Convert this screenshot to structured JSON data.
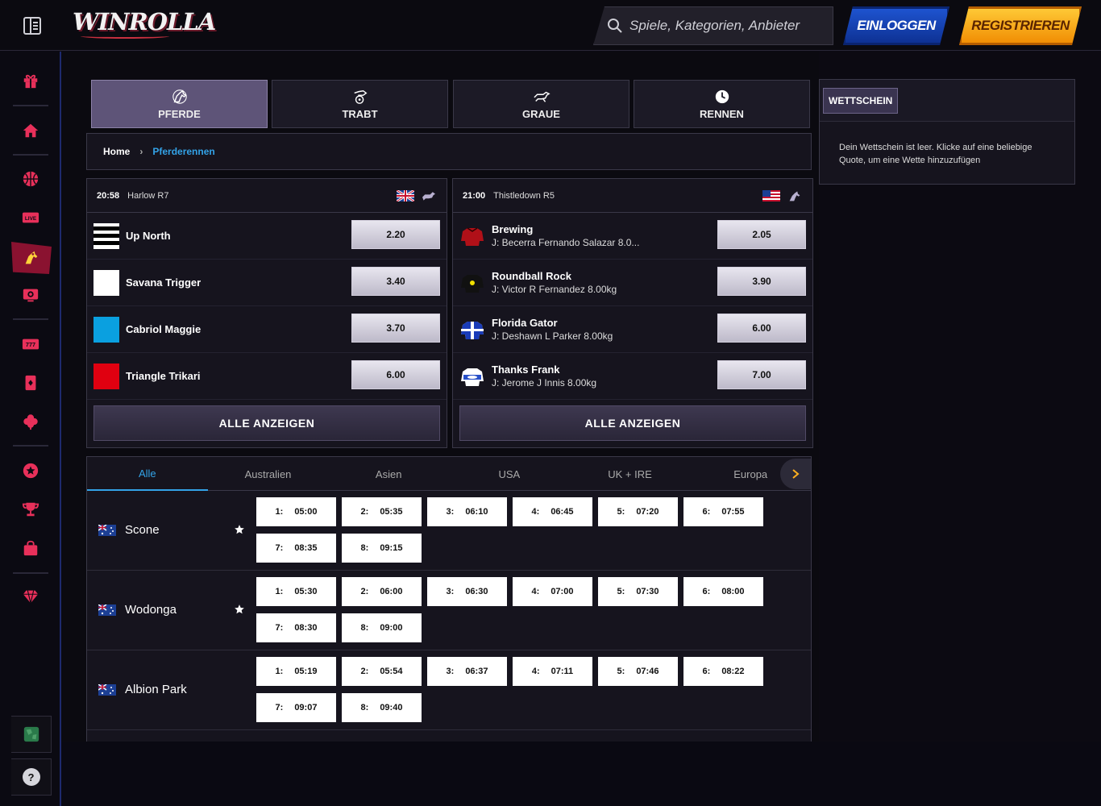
{
  "header": {
    "logo_text": "WINROLLA",
    "search_placeholder": "Spiele, Kategorien, Anbieter",
    "login_label": "EINLOGGEN",
    "register_label": "REGISTRIEREN"
  },
  "sidebar": {
    "live_badge": "LIVE",
    "slots_badge": "777",
    "help_label": "?"
  },
  "categories": [
    {
      "label": "PFERDE",
      "icon": "horse-icon",
      "active": true
    },
    {
      "label": "TRABT",
      "icon": "harness-icon",
      "active": false
    },
    {
      "label": "GRAUE",
      "icon": "greyhound-icon",
      "active": false
    },
    {
      "label": "RENNEN",
      "icon": "clock-icon",
      "active": false
    }
  ],
  "breadcrumb": {
    "home": "Home",
    "current": "Pferderennen"
  },
  "races": [
    {
      "time": "20:58",
      "name": "Harlow R7",
      "country_flag": "uk-flag-icon",
      "show_all": "ALLE ANZEIGEN",
      "runners": [
        {
          "name": "Up North",
          "jockey": "",
          "odds": "2.20"
        },
        {
          "name": "Savana Trigger",
          "jockey": "",
          "odds": "3.40"
        },
        {
          "name": "Cabriol Maggie",
          "jockey": "",
          "odds": "3.70"
        },
        {
          "name": "Triangle Trikari",
          "jockey": "",
          "odds": "6.00"
        }
      ]
    },
    {
      "time": "21:00",
      "name": "Thistledown R5",
      "country_flag": "us-flag-icon",
      "show_all": "ALLE ANZEIGEN",
      "runners": [
        {
          "name": "Brewing",
          "jockey": "J: Becerra Fernando Salazar 8.0...",
          "odds": "2.05"
        },
        {
          "name": "Roundball Rock",
          "jockey": "J: Victor R Fernandez 8.00kg",
          "odds": "3.90"
        },
        {
          "name": "Florida Gator",
          "jockey": "J: Deshawn L Parker 8.00kg",
          "odds": "6.00"
        },
        {
          "name": "Thanks Frank",
          "jockey": "J: Jerome J Innis 8.00kg",
          "odds": "7.00"
        }
      ]
    }
  ],
  "region_tabs": [
    "Alle",
    "Australien",
    "Asien",
    "USA",
    "UK + IRE",
    "Europa"
  ],
  "active_region": "Alle",
  "meetings": [
    {
      "name": "Scone",
      "starred": true,
      "times": [
        [
          "1:",
          "05:00"
        ],
        [
          "2:",
          "05:35"
        ],
        [
          "3:",
          "06:10"
        ],
        [
          "4:",
          "06:45"
        ],
        [
          "5:",
          "07:20"
        ],
        [
          "6:",
          "07:55"
        ],
        [
          "7:",
          "08:35"
        ],
        [
          "8:",
          "09:15"
        ]
      ]
    },
    {
      "name": "Wodonga",
      "starred": true,
      "times": [
        [
          "1:",
          "05:30"
        ],
        [
          "2:",
          "06:00"
        ],
        [
          "3:",
          "06:30"
        ],
        [
          "4:",
          "07:00"
        ],
        [
          "5:",
          "07:30"
        ],
        [
          "6:",
          "08:00"
        ],
        [
          "7:",
          "08:30"
        ],
        [
          "8:",
          "09:00"
        ]
      ]
    },
    {
      "name": "Albion Park",
      "starred": false,
      "times": [
        [
          "1:",
          "05:19"
        ],
        [
          "2:",
          "05:54"
        ],
        [
          "3:",
          "06:37"
        ],
        [
          "4:",
          "07:11"
        ],
        [
          "5:",
          "07:46"
        ],
        [
          "6:",
          "08:22"
        ],
        [
          "7:",
          "09:07"
        ],
        [
          "8:",
          "09:40"
        ]
      ]
    }
  ],
  "betslip": {
    "title": "WETTSCHEIN",
    "empty_message": "Dein Wettschein ist leer. Klicke auf eine beliebige Quote, um eine Wette hinzuzufügen"
  },
  "colors": {
    "accent_blue": "#33a3e8",
    "sidebar_red": "#e8305a",
    "login_blue": "#1f56d4",
    "register_orange": "#f5a400"
  }
}
